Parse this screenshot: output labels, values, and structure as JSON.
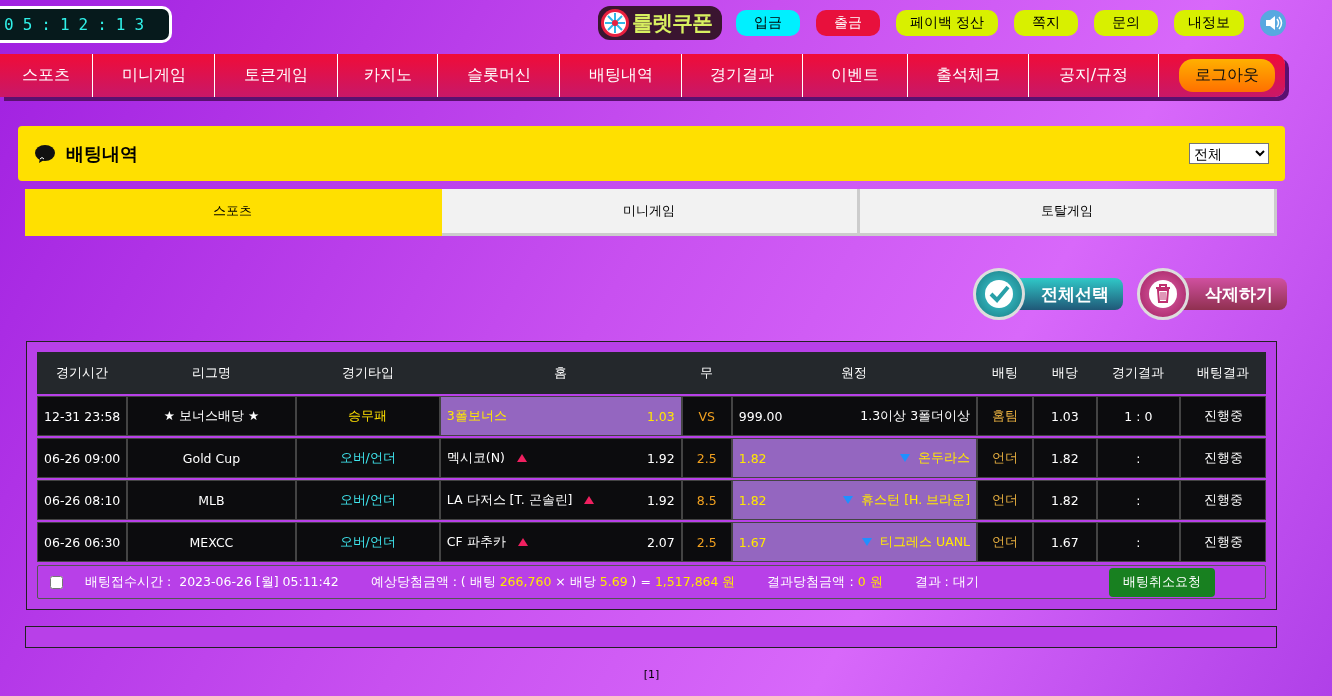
{
  "clock": "05:12:13",
  "logo": {
    "text": "룰렛쿠폰"
  },
  "top_buttons": [
    {
      "label": "입금",
      "color": "#00f0ff"
    },
    {
      "label": "출금",
      "color": "#e8103c"
    },
    {
      "label": "페이백 정산",
      "color": "#d8f000"
    },
    {
      "label": "쪽지",
      "color": "#d8f000"
    },
    {
      "label": "문의",
      "color": "#d8f000"
    },
    {
      "label": "내정보",
      "color": "#d8f000"
    }
  ],
  "nav": {
    "items": [
      "스포츠",
      "미니게임",
      "토큰게임",
      "카지노",
      "슬롯머신",
      "배팅내역",
      "경기결과",
      "이벤트",
      "출석체크",
      "공지/규정"
    ],
    "logout": "로그아웃"
  },
  "panel": {
    "title": "배팅내역",
    "filter": "전체"
  },
  "tabs": [
    {
      "label": "스포츠",
      "selected": true
    },
    {
      "label": "미니게임",
      "selected": false
    },
    {
      "label": "토탈게임",
      "selected": false
    }
  ],
  "actions": {
    "select_all": "전체선택",
    "delete": "삭제하기"
  },
  "table": {
    "columns": [
      "경기시간",
      "리그명",
      "경기타입",
      "홈",
      "무",
      "원정",
      "배팅",
      "배당",
      "경기결과",
      "배팅결과"
    ],
    "rows": [
      {
        "time": "12-31 23:58",
        "league": "★ 보너스배당 ★",
        "type": {
          "label": "승무패",
          "kind": "result"
        },
        "home": {
          "name": "3폴보너스",
          "odds": "1.03",
          "arrow": false,
          "selected": true
        },
        "draw": "VS",
        "away": {
          "odds": "999.00",
          "name": "1.3이상 3폴더이상",
          "arrow": false,
          "selected": false
        },
        "bet": "홈팀",
        "bet_odds": "1.03",
        "result": "1 : 0",
        "status": "진행중"
      },
      {
        "time": "06-26 09:00",
        "league": "Gold Cup",
        "type": {
          "label": "오버/언더",
          "kind": "overunder"
        },
        "home": {
          "name": "멕시코(N)",
          "odds": "1.92",
          "arrow": true,
          "selected": false
        },
        "draw": "2.5",
        "away": {
          "odds": "1.82",
          "name": "온두라스",
          "arrow": true,
          "selected": true
        },
        "bet": "언더",
        "bet_odds": "1.82",
        "result": ":",
        "status": "진행중"
      },
      {
        "time": "06-26 08:10",
        "league": "MLB",
        "type": {
          "label": "오버/언더",
          "kind": "overunder"
        },
        "home": {
          "name": "LA 다저스 [T. 곤솔린]",
          "odds": "1.92",
          "arrow": true,
          "selected": false
        },
        "draw": "8.5",
        "away": {
          "odds": "1.82",
          "name": "휴스턴 [H. 브라운]",
          "arrow": true,
          "selected": true
        },
        "bet": "언더",
        "bet_odds": "1.82",
        "result": ":",
        "status": "진행중"
      },
      {
        "time": "06-26 06:30",
        "league": "MEXCC",
        "type": {
          "label": "오버/언더",
          "kind": "overunder"
        },
        "home": {
          "name": "CF 파추카",
          "odds": "2.07",
          "arrow": true,
          "selected": false
        },
        "draw": "2.5",
        "away": {
          "odds": "1.67",
          "name": "티그레스 UANL",
          "arrow": true,
          "selected": true
        },
        "bet": "언더",
        "bet_odds": "1.67",
        "result": ":",
        "status": "진행중"
      }
    ]
  },
  "summary": {
    "checked": false,
    "time_label": "배팅접수시간 :",
    "time_value": "2023-06-26 [월] 05:11:42",
    "expected": "예상당첨금액 : ( 배팅 **266,760** × 배당 **5.69** ) = **1,517,864 원**",
    "won": "결과당첨금액 : **0 원**",
    "result": "결과 : 대기",
    "cancel": "배팅취소요청"
  },
  "pagination": "[1]"
}
